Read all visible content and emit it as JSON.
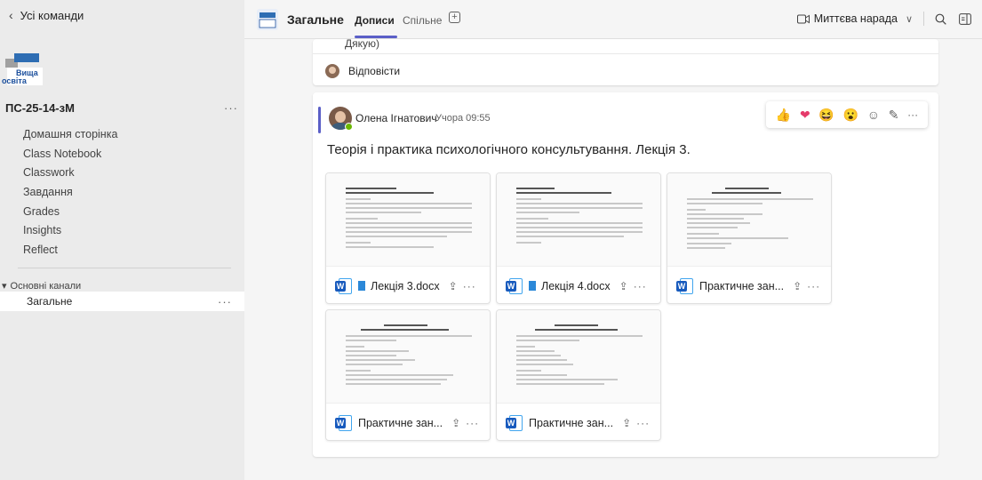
{
  "sidebar": {
    "back_label": "Усі команди",
    "team_name": "ПС-25-14-зМ",
    "team_more": "···",
    "nav": [
      "Домашня сторінка",
      "Class Notebook",
      "Classwork",
      "Завдання",
      "Grades",
      "Insights",
      "Reflect"
    ],
    "channels_header": "Основні канали",
    "channel": "Загальне",
    "channel_more": "···",
    "logo_text_1": "Вища",
    "logo_text_2": "освіта"
  },
  "header": {
    "title": "Загальне",
    "tabs": [
      "Дописи",
      "Спільне"
    ],
    "meet_label": "Миттєва нарада",
    "add_tab": "+"
  },
  "prev_post": {
    "tail_text": "Дякую)",
    "reply_label": "Відповісти"
  },
  "post": {
    "author": "Олена Ігнатович",
    "time": "Учора 09:55",
    "title": "Теорія і практика психологічного консультування. Лекція 3.",
    "reactions": [
      "👍",
      "❤",
      "😆",
      "😮",
      "☺",
      "✎",
      "···"
    ],
    "files": [
      {
        "name": "Лекція 3.docx"
      },
      {
        "name": "Лекція 4.docx"
      },
      {
        "name": "Практичне зан..."
      },
      {
        "name": "Практичне зан..."
      },
      {
        "name": "Практичне зан..."
      }
    ]
  },
  "colors": {
    "accent": "#5b5fc7",
    "word": "#185abd",
    "presence": "#6bb700"
  }
}
